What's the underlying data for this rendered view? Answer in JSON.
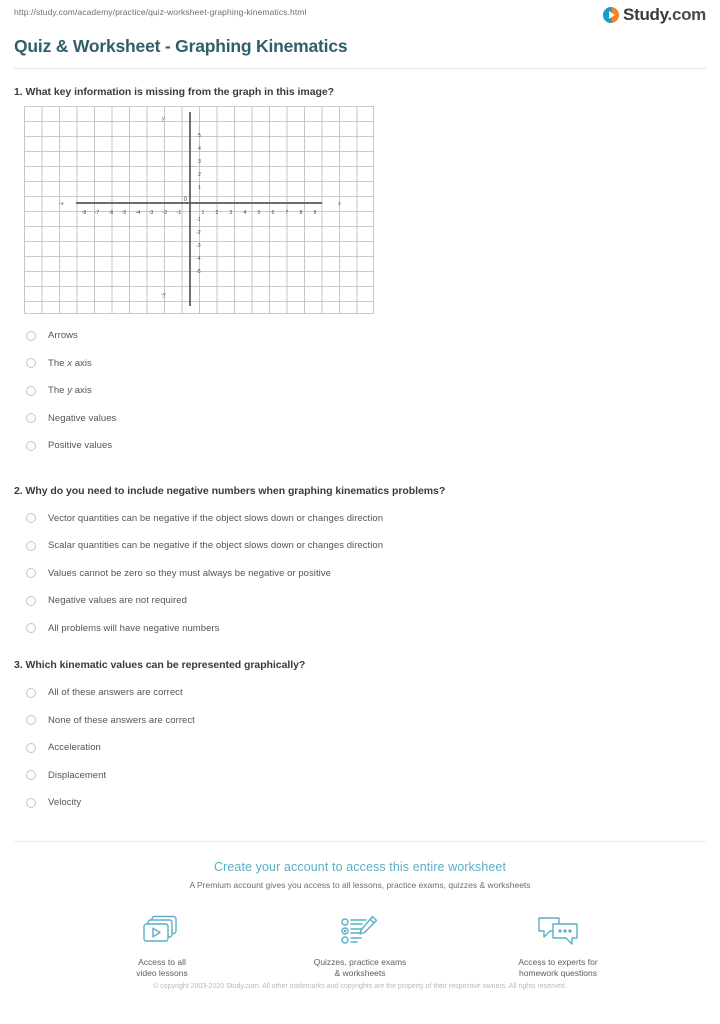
{
  "browser": {
    "url": "http://study.com/academy/practice/quiz-worksheet-graphing-kinematics.html"
  },
  "brand": {
    "name_primary": "Study",
    "name_suffix": ".com",
    "logo_icon": "play-circle-icon",
    "orange": "#f5821f",
    "teal": "#1a9cc7"
  },
  "header": {
    "title": "Quiz & Worksheet - Graphing Kinematics",
    "title_color": "#2e5f6b"
  },
  "questions": [
    {
      "number": "1.",
      "text": "1. What key information is missing from the graph in this image?",
      "has_figure": true,
      "options": [
        {
          "label": "Arrows"
        },
        {
          "label": "The x axis",
          "pre": "The ",
          "italic": "x",
          "post": " axis"
        },
        {
          "label": "The y axis",
          "pre": "The ",
          "italic": "y",
          "post": " axis"
        },
        {
          "label": "Negative values"
        },
        {
          "label": "Positive values"
        }
      ]
    },
    {
      "number": "2.",
      "text": "2. Why do you need to include negative numbers when graphing kinematics problems?",
      "has_figure": false,
      "options": [
        {
          "label": "Vector quantities can be negative if the object slows down or changes direction"
        },
        {
          "label": "Scalar quantities can be negative if the object slows down or changes direction"
        },
        {
          "label": "Values cannot be zero so they must always be negative or positive"
        },
        {
          "label": "Negative values are not required"
        },
        {
          "label": "All problems will have negative numbers"
        }
      ]
    },
    {
      "number": "3.",
      "text": "3. Which kinematic values can be represented graphically?",
      "has_figure": false,
      "options": [
        {
          "label": "All of these answers are correct"
        },
        {
          "label": "None of these answers are correct"
        },
        {
          "label": "Acceleration"
        },
        {
          "label": "Displacement"
        },
        {
          "label": "Velocity"
        }
      ]
    }
  ],
  "chart_data": {
    "type": "scatter",
    "title": "",
    "description": "Cartesian coordinate grid with horizontal and vertical axes drawn but no arrowheads",
    "xlabel": "x",
    "xlabel_negative": "-x",
    "ylabel": "y",
    "ylabel_negative": "-y",
    "origin_label": "0",
    "x_ticks": [
      -8,
      -7,
      -6,
      -5,
      -4,
      -3,
      -2,
      -1,
      1,
      2,
      3,
      4,
      5,
      6,
      7,
      8,
      9
    ],
    "y_ticks": [
      5,
      4,
      3,
      2,
      1,
      -1,
      -2,
      -3,
      -4,
      -5
    ],
    "xlim": [
      -10.5,
      11.5
    ],
    "ylim": [
      -7,
      6.5
    ],
    "grid": true,
    "grid_color": "#b5b5b5",
    "axis_color": "#58585a",
    "series": [],
    "values": []
  },
  "cta": {
    "title": "Create your account to access this entire worksheet",
    "subtitle": "A Premium account gives you access to all lessons, practice exams, quizzes & worksheets",
    "accent": "#5aafc6",
    "perks": [
      {
        "icon": "video-lessons-icon",
        "line1": "Access to all",
        "line2": "video lessons"
      },
      {
        "icon": "quiz-worksheet-icon",
        "line1": "Quizzes, practice exams",
        "line2": "& worksheets"
      },
      {
        "icon": "chat-experts-icon",
        "line1": "Access to experts for",
        "line2": "homework questions"
      }
    ]
  },
  "footer": {
    "copyright": "© copyright 2003-2020 Study.com. All other trademarks and copyrights are the property of their respective owners. All rights reserved."
  }
}
